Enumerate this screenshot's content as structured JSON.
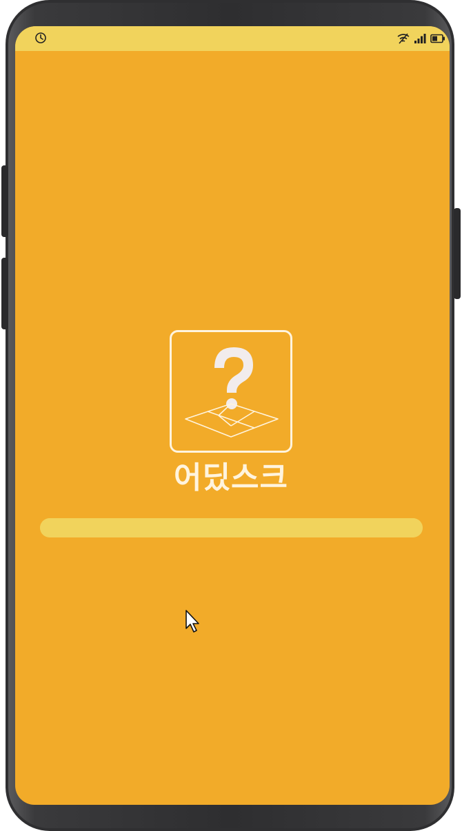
{
  "app": {
    "name": "어딨스크",
    "background_color": "#f2ab29",
    "accent_color": "#f1d35c",
    "logo_icon": "question-map-icon"
  },
  "status_bar": {
    "left_icon": "clock-icon",
    "right_icons": [
      "wifi-off-icon",
      "signal-icon",
      "battery-icon"
    ]
  },
  "loading": {
    "progress": 1.0
  }
}
